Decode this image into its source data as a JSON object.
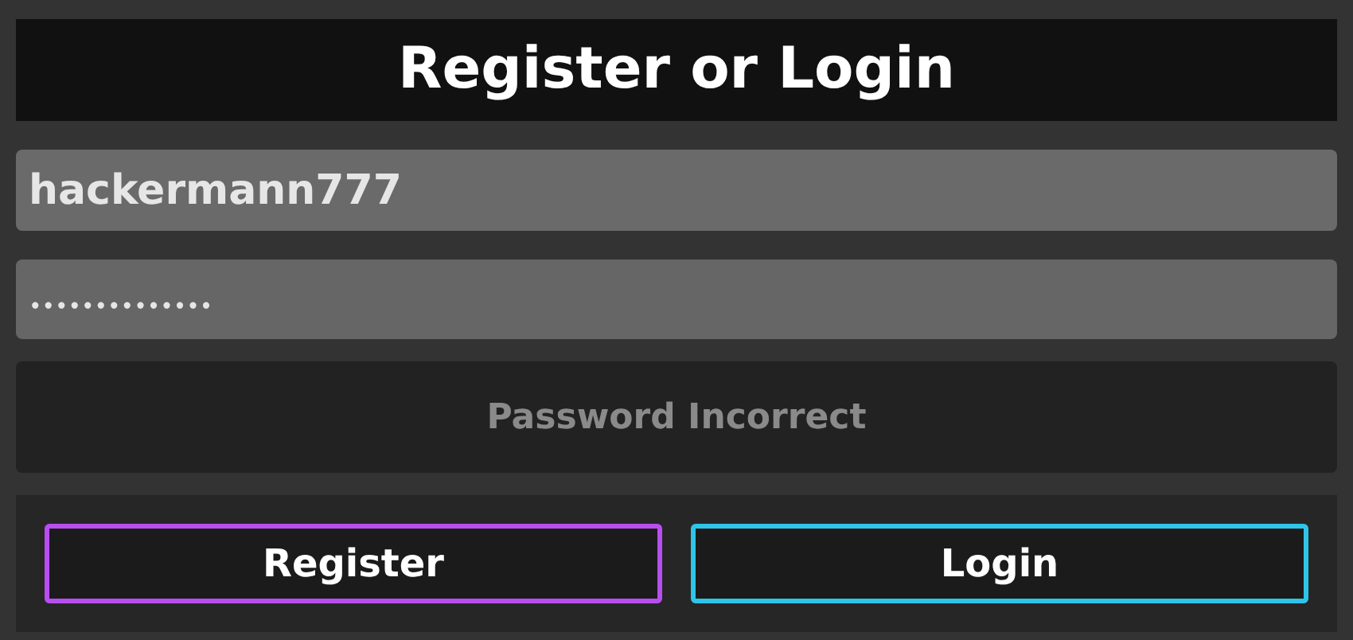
{
  "title": "Register or Login",
  "username": {
    "value": "hackermann777"
  },
  "password": {
    "value": "••••••••••••••"
  },
  "message": "Password Incorrect",
  "buttons": [
    {
      "label": "Register",
      "color": "#b84ef0"
    },
    {
      "label": "Login",
      "color": "#2ec5e8"
    }
  ]
}
